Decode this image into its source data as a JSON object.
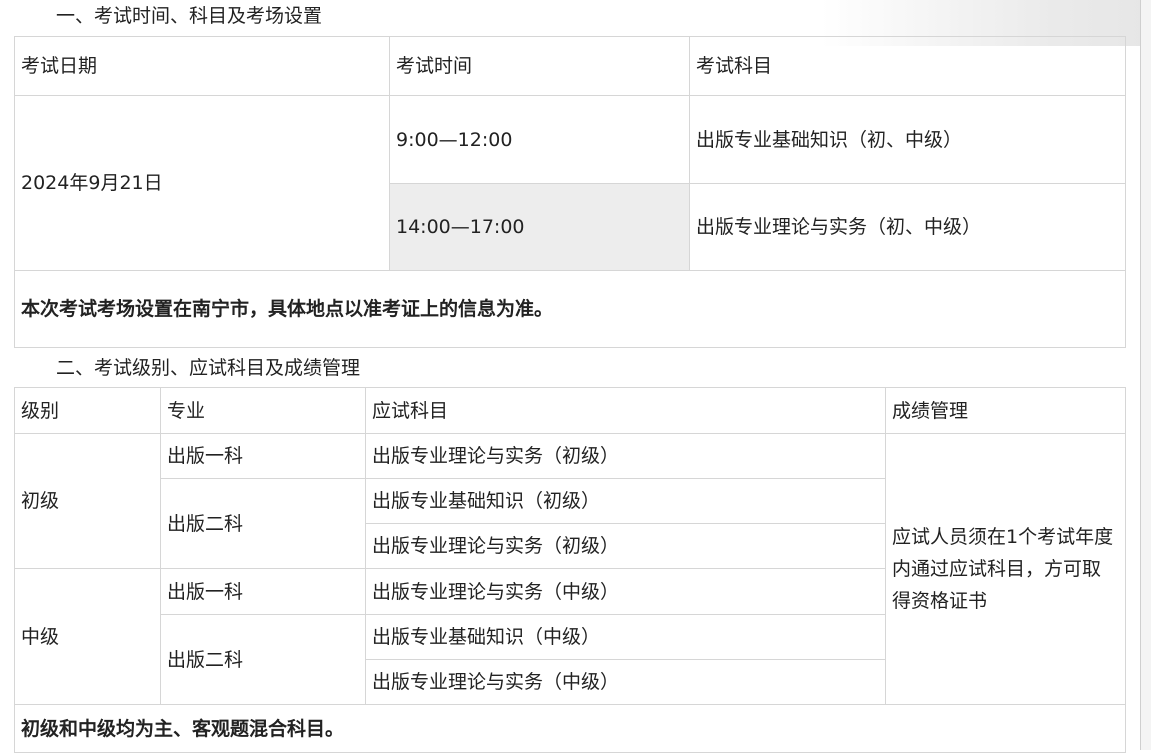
{
  "section1": {
    "heading": "一、考试时间、科目及考场设置",
    "headers": [
      "考试日期",
      "考试时间",
      "考试科目"
    ],
    "date": "2024年9月21日",
    "sessions": [
      {
        "time": "9:00—12:00",
        "subject": "出版专业基础知识（初、中级）"
      },
      {
        "time": "14:00—17:00",
        "subject": "出版专业理论与实务（初、中级）"
      }
    ],
    "note": "本次考试考场设置在南宁市，具体地点以准考证上的信息为准。"
  },
  "section2": {
    "heading": "二、考试级别、应试科目及成绩管理",
    "headers": [
      "级别",
      "专业",
      "应试科目",
      "成绩管理"
    ],
    "levels": [
      {
        "name": "初级",
        "majors": [
          {
            "name": "出版一科",
            "subjects": [
              "出版专业理论与实务（初级）"
            ]
          },
          {
            "name": "出版二科",
            "subjects": [
              "出版专业基础知识（初级）",
              "出版专业理论与实务（初级）"
            ]
          }
        ]
      },
      {
        "name": "中级",
        "majors": [
          {
            "name": "出版一科",
            "subjects": [
              "出版专业理论与实务（中级）"
            ]
          },
          {
            "name": "出版二科",
            "subjects": [
              "出版专业基础知识（中级）",
              "出版专业理论与实务（中级）"
            ]
          }
        ]
      }
    ],
    "score_management": "应试人员须在1个考试年度内通过应试科目，方可取得资格证书",
    "note": "初级和中级均为主、客观题混合科目。"
  }
}
